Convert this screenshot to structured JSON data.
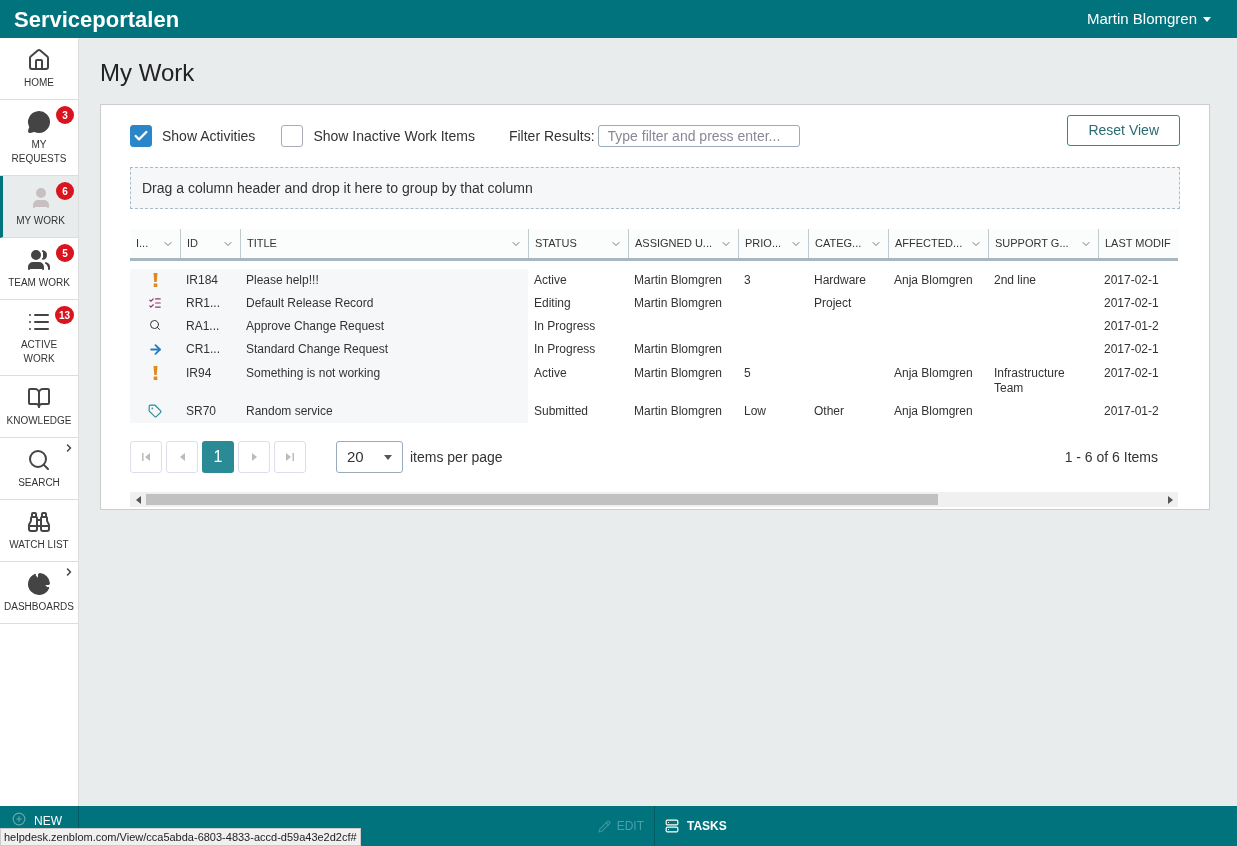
{
  "header": {
    "title": "Serviceportalen",
    "user": "Martin Blomgren"
  },
  "sidebar": {
    "items": [
      {
        "kind": "home",
        "label": "HOME",
        "selected": false
      },
      {
        "kind": "requests",
        "label": "MY REQUESTS",
        "badge": "3",
        "selected": false
      },
      {
        "kind": "mywork",
        "label": "MY WORK",
        "badge": "6",
        "selected": true
      },
      {
        "kind": "team",
        "label": "TEAM WORK",
        "badge": "5",
        "selected": false
      },
      {
        "kind": "active",
        "label": "ACTIVE WORK",
        "badge": "13",
        "selected": false
      },
      {
        "kind": "knowledge",
        "label": "KNOWLEDGE",
        "selected": false
      },
      {
        "kind": "search",
        "label": "SEARCH",
        "submenu": true,
        "selected": false
      },
      {
        "kind": "watch",
        "label": "WATCH LIST",
        "selected": false
      },
      {
        "kind": "dashboards",
        "label": "DASHBOARDS",
        "submenu": true,
        "selected": false
      }
    ]
  },
  "page_title": "My Work",
  "toolbar": {
    "show_activities": {
      "label": "Show Activities",
      "checked": true
    },
    "show_inactive": {
      "label": "Show Inactive Work Items",
      "checked": false
    },
    "filter_label": "Filter Results:",
    "filter_placeholder": "Type filter and press enter...",
    "reset": "Reset View"
  },
  "group_hint": "Drag a column header and drop it here to group by that column",
  "table": {
    "columns": [
      "I...",
      "ID",
      "TITLE",
      "STATUS",
      "ASSIGNED U...",
      "PRIO...",
      "CATEG...",
      "AFFECTED...",
      "SUPPORT G...",
      "LAST MODIF"
    ],
    "rows": [
      {
        "kind": "incident",
        "cells": [
          "",
          "IR184",
          "Please help!!!",
          "Active",
          "Martin Blomgren",
          "3",
          "Hardware",
          "Anja Blomgren",
          "2nd line",
          "2017-02-1"
        ]
      },
      {
        "kind": "release",
        "cells": [
          "",
          "RR1...",
          "Default Release Record",
          "Editing",
          "Martin Blomgren",
          "",
          "Project",
          "",
          "",
          "2017-02-1"
        ]
      },
      {
        "kind": "review",
        "cells": [
          "",
          "RA1...",
          "Approve Change Request",
          "In Progress",
          "",
          "",
          "",
          "",
          "",
          "2017-01-2"
        ]
      },
      {
        "kind": "change",
        "cells": [
          "",
          "CR1...",
          "Standard Change Request",
          "In Progress",
          "Martin Blomgren",
          "",
          "",
          "",
          "",
          "2017-02-1"
        ]
      },
      {
        "kind": "incident",
        "cells": [
          "",
          "IR94",
          "Something is not working",
          "Active",
          "Martin Blomgren",
          "5",
          "",
          "Anja Blomgren",
          "Infrastructure Team",
          "2017-02-1"
        ]
      },
      {
        "kind": "service",
        "cells": [
          "",
          "SR70",
          "Random service",
          "Submitted",
          "Martin Blomgren",
          "Low",
          "Other",
          "Anja Blomgren",
          "",
          "2017-01-2"
        ]
      }
    ]
  },
  "pager": {
    "pages": [
      {
        "label": "1",
        "selected": true
      }
    ],
    "page_size": "20",
    "per_page_label": "items per page",
    "summary": "1 - 6 of 6 Items"
  },
  "bottom_bar": {
    "new": "NEW",
    "edit": {
      "label": "EDIT",
      "disabled": true
    },
    "tasks": "TASKS"
  },
  "status_url": "helpdesk.zenblom.com/View/cca5abda-6803-4833-accd-d59a43e2d2cf#"
}
